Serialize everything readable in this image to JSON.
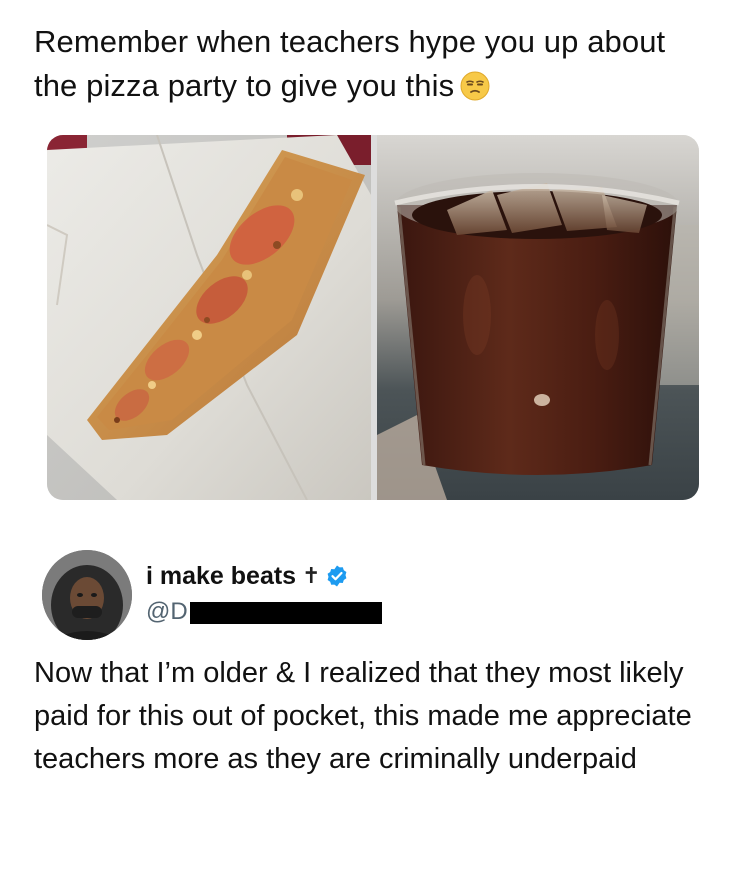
{
  "original_post": {
    "text": "Remember when teachers hype you up about the pizza party to give you this",
    "emoji": "unamused-face-emoji"
  },
  "media": {
    "images": [
      {
        "subject": "pizza-slice-photo"
      },
      {
        "subject": "soda-cup-photo"
      }
    ]
  },
  "quote_post": {
    "display_name": "i make beats",
    "name_symbol": "✝",
    "verified": true,
    "handle_prefix": "@D",
    "reply_text": "Now that I’m older & I realized that they most likely paid for this out of pocket, this made me appreciate teachers more as they are criminally underpaid"
  },
  "colors": {
    "verified_blue": "#1d9bf0",
    "handle_gray": "#536471",
    "text": "#111111"
  }
}
